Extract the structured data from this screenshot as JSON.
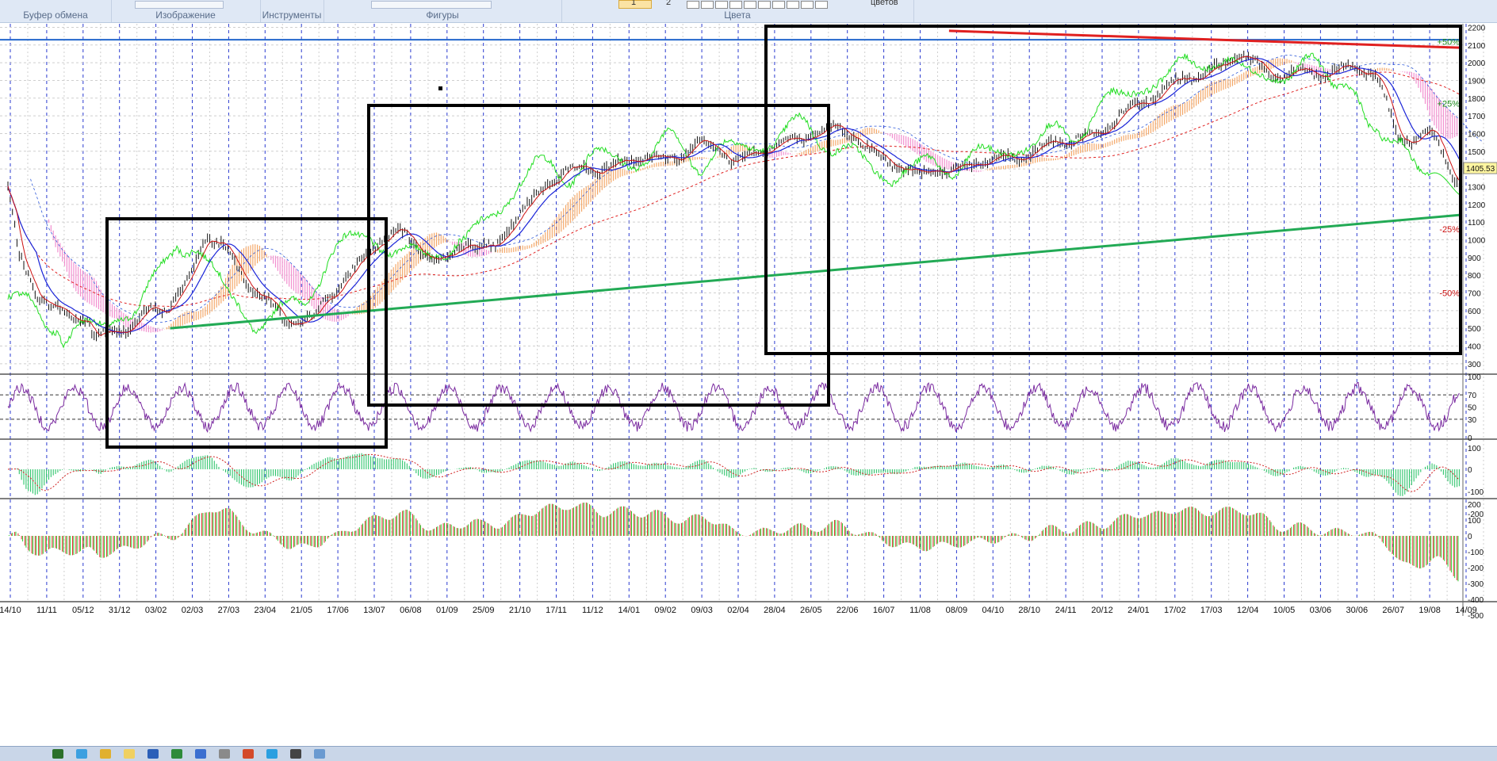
{
  "ribbon": {
    "groups": [
      {
        "label": "Буфер обмена"
      },
      {
        "label": "Изображение"
      },
      {
        "label": "Инструменты"
      },
      {
        "label": "Фигуры"
      },
      {
        "label": "Цвета"
      }
    ],
    "color1": "1",
    "color2": "2",
    "colors_label": "цветов"
  },
  "chart_data": {
    "type": "line",
    "title": "",
    "x_labels": [
      "14/10",
      "11/11",
      "05/12",
      "31/12",
      "03/02",
      "02/03",
      "27/03",
      "23/04",
      "21/05",
      "17/06",
      "13/07",
      "06/08",
      "01/09",
      "25/09",
      "21/10",
      "17/11",
      "11/12",
      "14/01",
      "09/02",
      "09/03",
      "02/04",
      "28/04",
      "26/05",
      "22/06",
      "16/07",
      "11/08",
      "08/09",
      "04/10",
      "28/10",
      "24/11",
      "20/12",
      "24/01",
      "17/02",
      "17/03",
      "12/04",
      "10/05",
      "03/06",
      "30/06",
      "26/07",
      "19/08",
      "14/09"
    ],
    "price_axis": {
      "ticks": [
        300,
        400,
        500,
        600,
        700,
        800,
        900,
        1000,
        1100,
        1200,
        1300,
        1400,
        1500,
        1600,
        1700,
        1800,
        1900,
        2000,
        2100,
        2200
      ],
      "min": 250,
      "max": 2220
    },
    "current_price": "1405.53",
    "percent_labels": [
      {
        "text": "+50%",
        "value": 2120
      },
      {
        "text": "+25%",
        "value": 1770
      },
      {
        "text": "-25%",
        "value": 1060
      },
      {
        "text": "-50%",
        "value": 700
      }
    ],
    "price_anchors": [
      [
        0,
        1300
      ],
      [
        10,
        900
      ],
      [
        25,
        700
      ],
      [
        40,
        620
      ],
      [
        55,
        560
      ],
      [
        70,
        560
      ],
      [
        75,
        450
      ],
      [
        95,
        480
      ],
      [
        110,
        520
      ],
      [
        125,
        600
      ],
      [
        140,
        610
      ],
      [
        160,
        780
      ],
      [
        175,
        1020
      ],
      [
        190,
        980
      ],
      [
        200,
        850
      ],
      [
        210,
        770
      ],
      [
        220,
        700
      ],
      [
        230,
        660
      ],
      [
        245,
        520
      ],
      [
        258,
        540
      ],
      [
        270,
        570
      ],
      [
        285,
        690
      ],
      [
        300,
        800
      ],
      [
        315,
        900
      ],
      [
        330,
        1010
      ],
      [
        345,
        1050
      ],
      [
        360,
        960
      ],
      [
        375,
        900
      ],
      [
        385,
        880
      ],
      [
        395,
        930
      ],
      [
        405,
        1000
      ],
      [
        415,
        960
      ],
      [
        430,
        950
      ],
      [
        445,
        1100
      ],
      [
        460,
        1200
      ],
      [
        475,
        1320
      ],
      [
        490,
        1380
      ],
      [
        505,
        1410
      ],
      [
        520,
        1390
      ],
      [
        535,
        1420
      ],
      [
        550,
        1460
      ],
      [
        565,
        1470
      ],
      [
        580,
        1450
      ],
      [
        595,
        1480
      ],
      [
        610,
        1560
      ],
      [
        625,
        1520
      ],
      [
        640,
        1440
      ],
      [
        655,
        1480
      ],
      [
        670,
        1520
      ],
      [
        685,
        1550
      ],
      [
        700,
        1570
      ],
      [
        715,
        1600
      ],
      [
        730,
        1640
      ],
      [
        745,
        1600
      ],
      [
        760,
        1500
      ],
      [
        775,
        1450
      ],
      [
        790,
        1400
      ],
      [
        805,
        1370
      ],
      [
        815,
        1410
      ],
      [
        830,
        1380
      ],
      [
        845,
        1420
      ],
      [
        860,
        1440
      ],
      [
        875,
        1460
      ],
      [
        890,
        1460
      ],
      [
        905,
        1500
      ],
      [
        920,
        1550
      ],
      [
        935,
        1560
      ],
      [
        950,
        1580
      ],
      [
        965,
        1600
      ],
      [
        980,
        1700
      ],
      [
        995,
        1760
      ],
      [
        1010,
        1800
      ],
      [
        1025,
        1880
      ],
      [
        1040,
        1920
      ],
      [
        1055,
        1930
      ],
      [
        1070,
        1980
      ],
      [
        1085,
        2060
      ],
      [
        1100,
        2000
      ],
      [
        1115,
        1920
      ],
      [
        1130,
        1950
      ],
      [
        1145,
        1950
      ],
      [
        1160,
        1930
      ],
      [
        1175,
        1970
      ],
      [
        1190,
        1960
      ],
      [
        1205,
        1940
      ],
      [
        1215,
        1800
      ],
      [
        1225,
        1580
      ],
      [
        1240,
        1560
      ],
      [
        1255,
        1620
      ],
      [
        1265,
        1500
      ],
      [
        1275,
        1340
      ],
      [
        1280,
        1320
      ]
    ],
    "rsi_axis": {
      "ticks": [
        0,
        30,
        50,
        70,
        100
      ],
      "min": 0,
      "max": 100,
      "levels": [
        30,
        70
      ]
    },
    "macd_axis": {
      "ticks": [
        100,
        0,
        -100,
        -200
      ]
    },
    "osc_axis": {
      "ticks": [
        200,
        100,
        0,
        -100,
        -200,
        -300,
        -400,
        -500
      ]
    },
    "trendlines": [
      {
        "color": "#22aa55",
        "from": [
          143,
          500
        ],
        "to": [
          1280,
          1140
        ]
      },
      {
        "color": "#e02020",
        "from": [
          830,
          2180
        ],
        "to": [
          1280,
          2085
        ]
      }
    ],
    "support_line": {
      "color": "#2266cc",
      "value": 2130
    }
  },
  "taskbar": {
    "icons": [
      "start-icon",
      "ie-icon",
      "explorer-icon",
      "folder-icon",
      "word-icon",
      "excel-icon",
      "outlook-icon",
      "media-icon",
      "chrome-icon",
      "skype-icon",
      "terminal-icon",
      "paint-icon"
    ]
  }
}
